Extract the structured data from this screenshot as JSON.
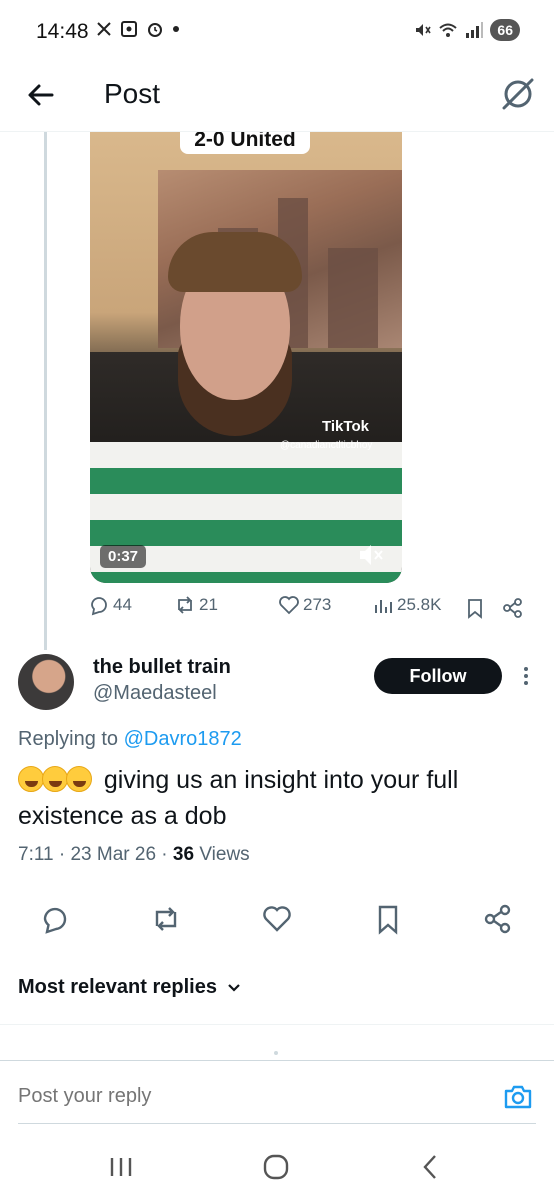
{
  "status_bar": {
    "time": "14:48",
    "battery": "66",
    "left_icons": [
      "x-icon",
      "screenshot-icon",
      "alarm-icon",
      "dot-icon"
    ],
    "right_icons": [
      "mute-icon",
      "wifi-icon",
      "signal-icon"
    ]
  },
  "header": {
    "title": "Post",
    "back_icon": "arrow-left-icon",
    "grok_icon": "grok-icon"
  },
  "video": {
    "caption_text": "2-0 United",
    "tiktok_label": "TikTok",
    "tiktok_handle": "@canadianctlticbhoy",
    "duration": "0:37",
    "mute_icon": "speaker-muted-icon"
  },
  "metrics": {
    "replies": "44",
    "reposts": "21",
    "likes": "273",
    "views": "25.8K"
  },
  "reply": {
    "display_name": "the bullet train",
    "handle": "@Maedasteel",
    "follow_label": "Follow",
    "replying_to_prefix": "Replying to ",
    "replying_to_mention": "@Davro1872",
    "text": "giving us an insight into your full existence as a dob",
    "emoji_count": 3,
    "time": "7:11",
    "date": "23 Mar 26",
    "views_count": "36",
    "views_label": "Views"
  },
  "actions": [
    "reply-icon",
    "repost-icon",
    "like-icon",
    "bookmark-icon",
    "share-icon"
  ],
  "sort": {
    "label": "Most relevant replies"
  },
  "composer": {
    "placeholder": "Post your reply"
  },
  "colors": {
    "accent": "#1d9bf0",
    "text_primary": "#0f1419",
    "text_secondary": "#536471",
    "follow_bg": "#0f1419"
  }
}
